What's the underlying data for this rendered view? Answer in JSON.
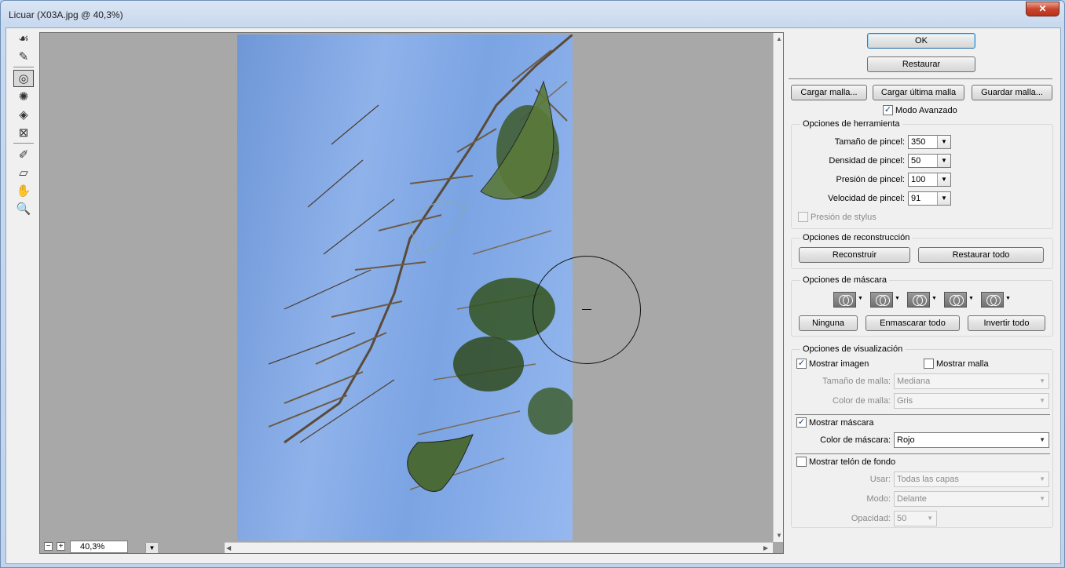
{
  "window": {
    "title": "Licuar (X03A.jpg @ 40,3%)",
    "close_label": "✕"
  },
  "toolbar": {
    "tools": [
      {
        "icon": "forward-warp-icon",
        "glyph": "☙",
        "active": false
      },
      {
        "icon": "reconstruct-icon",
        "glyph": "✎",
        "active": false
      },
      {
        "icon": "twirl-icon",
        "glyph": "◎",
        "active": true
      },
      {
        "icon": "pucker-icon",
        "glyph": "✺",
        "active": false
      },
      {
        "icon": "bloat-icon",
        "glyph": "◈",
        "active": false
      },
      {
        "icon": "push-left-icon",
        "glyph": "⊠",
        "active": false
      },
      {
        "icon": "freeze-mask-icon",
        "glyph": "✐",
        "active": false
      },
      {
        "icon": "thaw-mask-icon",
        "glyph": "▱",
        "active": false
      },
      {
        "icon": "hand-icon",
        "glyph": "✋",
        "active": false
      },
      {
        "icon": "zoom-icon",
        "glyph": "🔍",
        "active": false
      }
    ]
  },
  "preview": {
    "zoom_value": "40,3%",
    "minus": "−",
    "plus": "+"
  },
  "panel": {
    "ok": "OK",
    "restore": "Restaurar",
    "load_mesh": "Cargar malla...",
    "load_last_mesh": "Cargar última malla",
    "save_mesh": "Guardar malla...",
    "advanced_mode": "Modo Avanzado",
    "tool_options": {
      "title": "Opciones de herramienta",
      "brush_size_label": "Tamaño de pincel:",
      "brush_size": "350",
      "brush_density_label": "Densidad de pincel:",
      "brush_density": "50",
      "brush_pressure_label": "Presión de pincel:",
      "brush_pressure": "100",
      "brush_rate_label": "Velocidad de pincel:",
      "brush_rate": "91",
      "stylus_pressure": "Presión de stylus"
    },
    "reconstruct_options": {
      "title": "Opciones de reconstrucción",
      "reconstruct": "Reconstruir",
      "restore_all": "Restaurar todo"
    },
    "mask_options": {
      "title": "Opciones de máscara",
      "none": "Ninguna",
      "mask_all": "Enmascarar todo",
      "invert_all": "Invertir todo"
    },
    "view_options": {
      "title": "Opciones de visualización",
      "show_image": "Mostrar imagen",
      "show_mesh": "Mostrar malla",
      "mesh_size_label": "Tamaño de malla:",
      "mesh_size": "Mediana",
      "mesh_color_label": "Color de malla:",
      "mesh_color": "Gris",
      "show_mask": "Mostrar máscara",
      "mask_color_label": "Color de máscara:",
      "mask_color": "Rojo",
      "show_backdrop": "Mostrar telón de fondo",
      "use_label": "Usar:",
      "use_value": "Todas las capas",
      "mode_label": "Modo:",
      "mode_value": "Delante",
      "opacity_label": "Opacidad:",
      "opacity_value": "50"
    },
    "check_mark": "✓",
    "drop_arrow": "▼"
  }
}
